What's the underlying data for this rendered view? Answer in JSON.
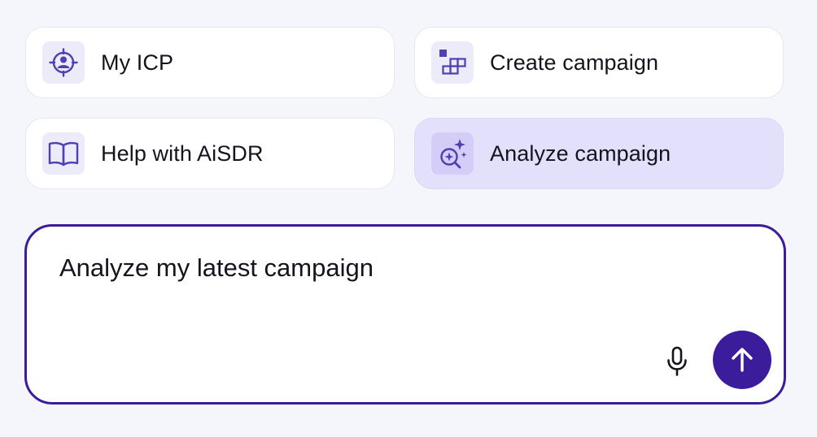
{
  "suggestions": {
    "my_icp": {
      "label": "My ICP",
      "icon": "target-person-icon"
    },
    "create_campaign": {
      "label": "Create campaign",
      "icon": "blocks-icon"
    },
    "help": {
      "label": "Help with AiSDR",
      "icon": "open-book-icon"
    },
    "analyze_campaign": {
      "label": "Analyze campaign",
      "icon": "sparkle-search-icon",
      "selected": true
    }
  },
  "composer": {
    "value": "Analyze my latest campaign",
    "mic_icon": "microphone-icon",
    "send_icon": "arrow-up-icon"
  },
  "colors": {
    "accent": "#3b1c9b",
    "icon_purple": "#4f3fb0",
    "selected_card": "#e3e0fb",
    "page_background": "#f5f6fb"
  }
}
